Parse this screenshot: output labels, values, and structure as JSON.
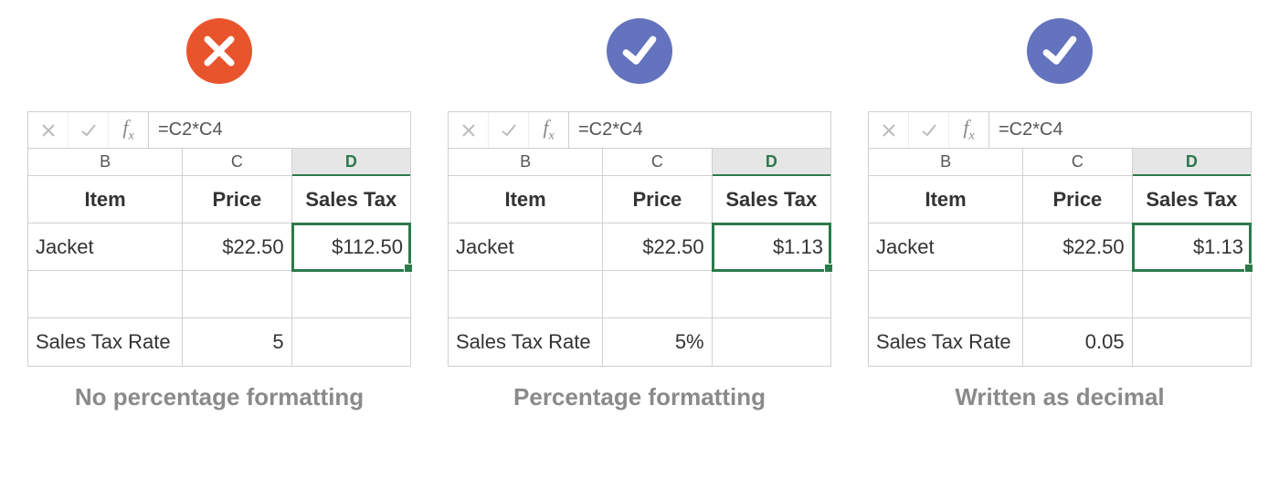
{
  "panels": [
    {
      "badge": "x",
      "formula": "=C2*C4",
      "columns": {
        "b": "B",
        "c": "C",
        "d": "D"
      },
      "headers": {
        "item": "Item",
        "price": "Price",
        "tax": "Sales Tax"
      },
      "row1": {
        "item": "Jacket",
        "price": "$22.50",
        "tax": "$112.50"
      },
      "row2": {
        "label": "Sales Tax Rate",
        "rate": "5"
      },
      "caption": "No percentage formatting"
    },
    {
      "badge": "check",
      "formula": "=C2*C4",
      "columns": {
        "b": "B",
        "c": "C",
        "d": "D"
      },
      "headers": {
        "item": "Item",
        "price": "Price",
        "tax": "Sales Tax"
      },
      "row1": {
        "item": "Jacket",
        "price": "$22.50",
        "tax": "$1.13"
      },
      "row2": {
        "label": "Sales Tax Rate",
        "rate": "5%"
      },
      "caption": "Percentage formatting"
    },
    {
      "badge": "check",
      "formula": "=C2*C4",
      "columns": {
        "b": "B",
        "c": "C",
        "d": "D"
      },
      "headers": {
        "item": "Item",
        "price": "Price",
        "tax": "Sales Tax"
      },
      "row1": {
        "item": "Jacket",
        "price": "$22.50",
        "tax": "$1.13"
      },
      "row2": {
        "label": "Sales Tax Rate",
        "rate": "0.05"
      },
      "caption": "Written as decimal"
    }
  ]
}
